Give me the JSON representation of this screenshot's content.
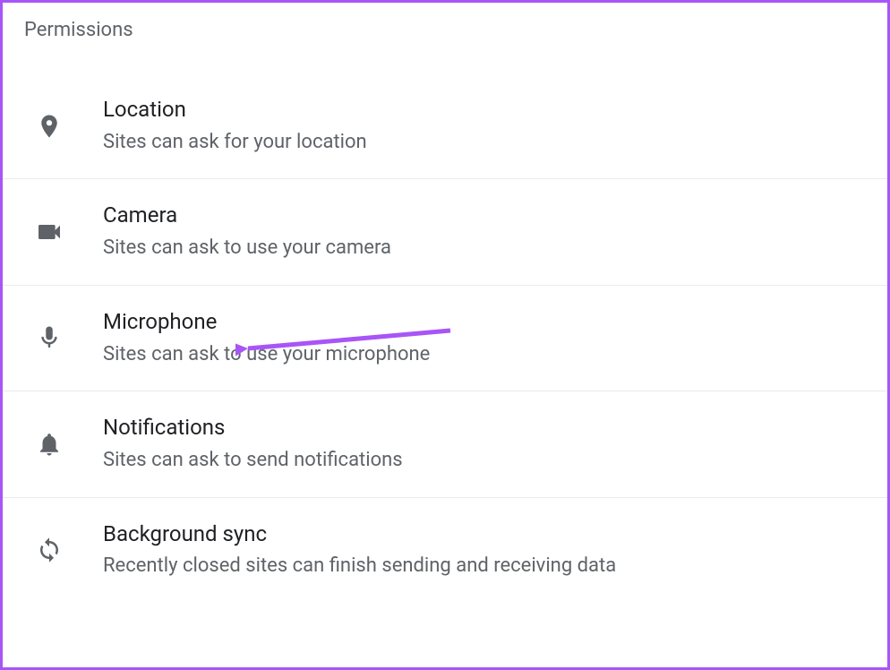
{
  "section_title": "Permissions",
  "items": [
    {
      "title": "Location",
      "subtitle": "Sites can ask for your location"
    },
    {
      "title": "Camera",
      "subtitle": "Sites can ask to use your camera"
    },
    {
      "title": "Microphone",
      "subtitle": "Sites can ask to use your microphone"
    },
    {
      "title": "Notifications",
      "subtitle": "Sites can ask to send notifications"
    },
    {
      "title": "Background sync",
      "subtitle": "Recently closed sites can finish sending and receiving data"
    }
  ]
}
